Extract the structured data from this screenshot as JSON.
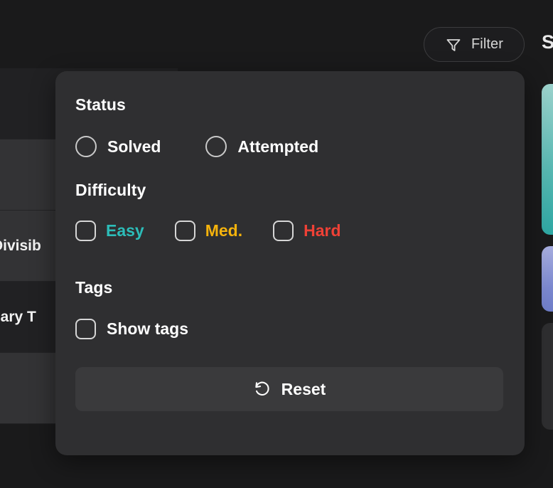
{
  "theme": {
    "page_bg": "#1a1a1b",
    "panel_bg": "#2f2f31",
    "text_primary": "#ffffff",
    "easy_color": "#2cbdb9",
    "medium_color": "#f5b30c",
    "hard_color": "#ef4136",
    "reset_bg": "#3a3a3c",
    "card_teal": "#58b8b2",
    "card_blue": "#7b88cf"
  },
  "topbar": {
    "filter_button_label": "Filter",
    "filter_icon": "funnel-icon",
    "overflow_text": "S"
  },
  "background_list": {
    "rows": [
      {
        "title": ""
      },
      {
        "title": ""
      },
      {
        "title": "-Divisib"
      },
      {
        "title": "inary T"
      },
      {
        "title": ""
      }
    ]
  },
  "filter_panel": {
    "sections": [
      {
        "title": "Status",
        "control_type": "radio",
        "options": [
          {
            "label": "Solved",
            "checked": false,
            "color": "#ffffff"
          },
          {
            "label": "Attempted",
            "checked": false,
            "color": "#ffffff"
          }
        ]
      },
      {
        "title": "Difficulty",
        "control_type": "checkbox",
        "options": [
          {
            "label": "Easy",
            "checked": false,
            "color": "#2cbdb9"
          },
          {
            "label": "Med.",
            "checked": false,
            "color": "#f5b30c"
          },
          {
            "label": "Hard",
            "checked": false,
            "color": "#ef4136"
          }
        ]
      },
      {
        "title": "Tags",
        "control_type": "checkbox",
        "options": [
          {
            "label": "Show tags",
            "checked": false,
            "color": "#ffffff"
          }
        ]
      }
    ],
    "reset": {
      "label": "Reset",
      "icon": "rotate-ccw-icon"
    }
  }
}
